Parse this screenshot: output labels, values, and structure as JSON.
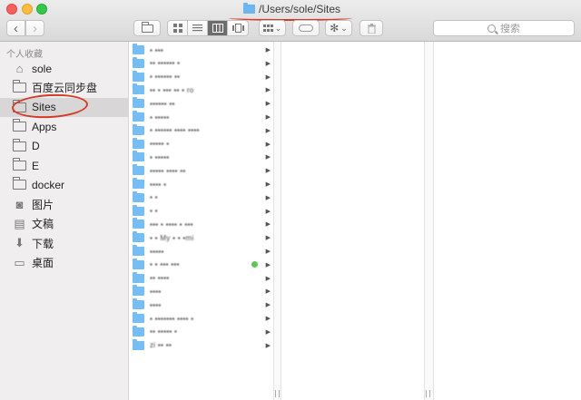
{
  "window": {
    "title": "/Users/sole/Sites"
  },
  "toolbar": {
    "back_glyph": "‹",
    "forward_glyph": "›",
    "view_icons": [
      "icon-view-icon",
      "list-view-icon",
      "column-view-icon",
      "cover-flow-view-icon"
    ],
    "active_view": "column",
    "search_placeholder": "搜索",
    "caret": "⌄",
    "gear_glyph": "✻",
    "trash_glyph": "🗑"
  },
  "sidebar": {
    "heading": "个人收藏",
    "items": [
      {
        "label": "sole",
        "icon": "home-icon",
        "glyph": "⌂"
      },
      {
        "label": "百度云同步盘",
        "icon": "folder-icon"
      },
      {
        "label": "Sites",
        "icon": "folder-icon",
        "selected": true
      },
      {
        "label": "Apps",
        "icon": "folder-icon"
      },
      {
        "label": "D",
        "icon": "folder-icon"
      },
      {
        "label": "E",
        "icon": "folder-icon"
      },
      {
        "label": "docker",
        "icon": "folder-icon"
      },
      {
        "label": "图片",
        "icon": "camera-icon",
        "glyph": "◙"
      },
      {
        "label": "文稿",
        "icon": "document-icon",
        "glyph": "▤"
      },
      {
        "label": "下载",
        "icon": "download-icon",
        "glyph": "⬇"
      },
      {
        "label": "桌面",
        "icon": "desktop-icon",
        "glyph": "▭"
      }
    ]
  },
  "colors": {
    "annotation_red": "#d53b26",
    "folder_blue": "#75bdf2",
    "tag_green": "#5ec952"
  },
  "column1": {
    "rows": [
      {
        "name": "▪ ▪▪▪"
      },
      {
        "name": "▪▪ ▪▪▪▪▪▪ ▪"
      },
      {
        "name": "▪ ▪▪▪▪▪▪ ▪▪"
      },
      {
        "name": "▪▪ ▪ ▪▪▪ ▪▪ ▪ ro"
      },
      {
        "name": "▪▪▪▪▪▪ ▪▪"
      },
      {
        "name": "▪ ▪▪▪▪▪"
      },
      {
        "name": "▪ ▪▪▪▪▪▪ ▪▪▪▪ ▪▪▪▪"
      },
      {
        "name": "▪▪▪▪▪ ▪"
      },
      {
        "name": "▪ ▪▪▪▪▪"
      },
      {
        "name": "▪▪▪▪▪ ▪▪▪▪ ▪▪"
      },
      {
        "name": "▪▪▪▪ ▪"
      },
      {
        "name": "▪ ▪"
      },
      {
        "name": "▪ ▪"
      },
      {
        "name": "▪▪▪ ▪ ▪▪▪▪ ▪ ▪▪▪"
      },
      {
        "name": "▪ ▪ My ▪ ▪ ▪mi"
      },
      {
        "name": "▪▪▪▪▪"
      },
      {
        "name": "▪ ▪ ▪▪▪ ▪▪▪",
        "tag": true
      },
      {
        "name": "▪▪ ▪▪▪▪"
      },
      {
        "name": "▪▪▪▪"
      },
      {
        "name": "▪▪▪▪"
      },
      {
        "name": "▪ ▪▪▪▪▪▪▪ ▪▪▪▪ ▪"
      },
      {
        "name": "▪▪ ▪▪▪▪▪ ▪"
      },
      {
        "name": "zi ▪▪ ▪▪"
      }
    ],
    "arrow_glyph": "▶"
  }
}
